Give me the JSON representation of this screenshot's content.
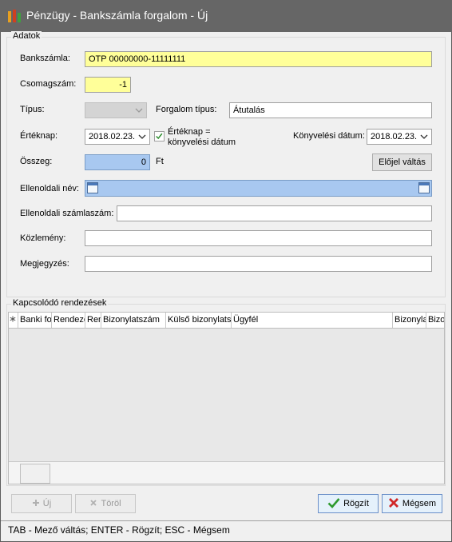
{
  "window": {
    "title": "Pénzügy - Bankszámla forgalom - Új"
  },
  "adatok": {
    "group_title": "Adatok",
    "bankszamla_label": "Bankszámla:",
    "bankszamla_value": "OTP 00000000-11111111",
    "csomagszam_label": "Csomagszám:",
    "csomagszam_value": "-1",
    "tipus_label": "Típus:",
    "tipus_value": "",
    "forgalom_tipus_label": "Forgalom típus:",
    "forgalom_tipus_value": "Átutalás",
    "erteknap_label": "Értéknap:",
    "erteknap_value": "2018.02.23.",
    "erteknap_eq_label": "Értéknap = könyvelési dátum",
    "erteknap_eq_checked": true,
    "konyvelesi_datum_label": "Könyvelési dátum:",
    "konyvelesi_datum_value": "2018.02.23.",
    "osszeg_label": "Összeg:",
    "osszeg_value": "0",
    "osszeg_unit": "Ft",
    "elojel_button": "Előjel váltás",
    "ellenoldali_nev_label": "Ellenoldali név:",
    "ellenoldali_nev_value": "",
    "ellenoldali_szamlaszam_label": "Ellenoldali számlaszám:",
    "ellenoldali_szamlaszam_value": "",
    "kozlemeny_label": "Közlemény:",
    "kozlemeny_value": "",
    "megjegyzes_label": "Megjegyzés:",
    "megjegyzes_value": ""
  },
  "kapcsolodo": {
    "group_title": "Kapcsolódó rendezések",
    "columns": [
      "",
      "Banki fo",
      "Rendeze",
      "Ren",
      "Bizonylatszám",
      "Külső bizonylats",
      "Ügyfél",
      "Bizonyla",
      "Bizo"
    ]
  },
  "buttons": {
    "uj": "Új",
    "torol": "Töröl",
    "rogzit": "Rögzít",
    "megsem": "Mégsem"
  },
  "status": {
    "text": "TAB - Mező váltás; ENTER - Rögzít; ESC - Mégsem"
  },
  "colors": {
    "titlebar": "#666666",
    "required_field": "#ffff99",
    "amount_field": "#a8c8f0"
  },
  "icons": {
    "app": "bars-chart-icon",
    "ok": "check-icon",
    "cancel": "cross-icon"
  }
}
